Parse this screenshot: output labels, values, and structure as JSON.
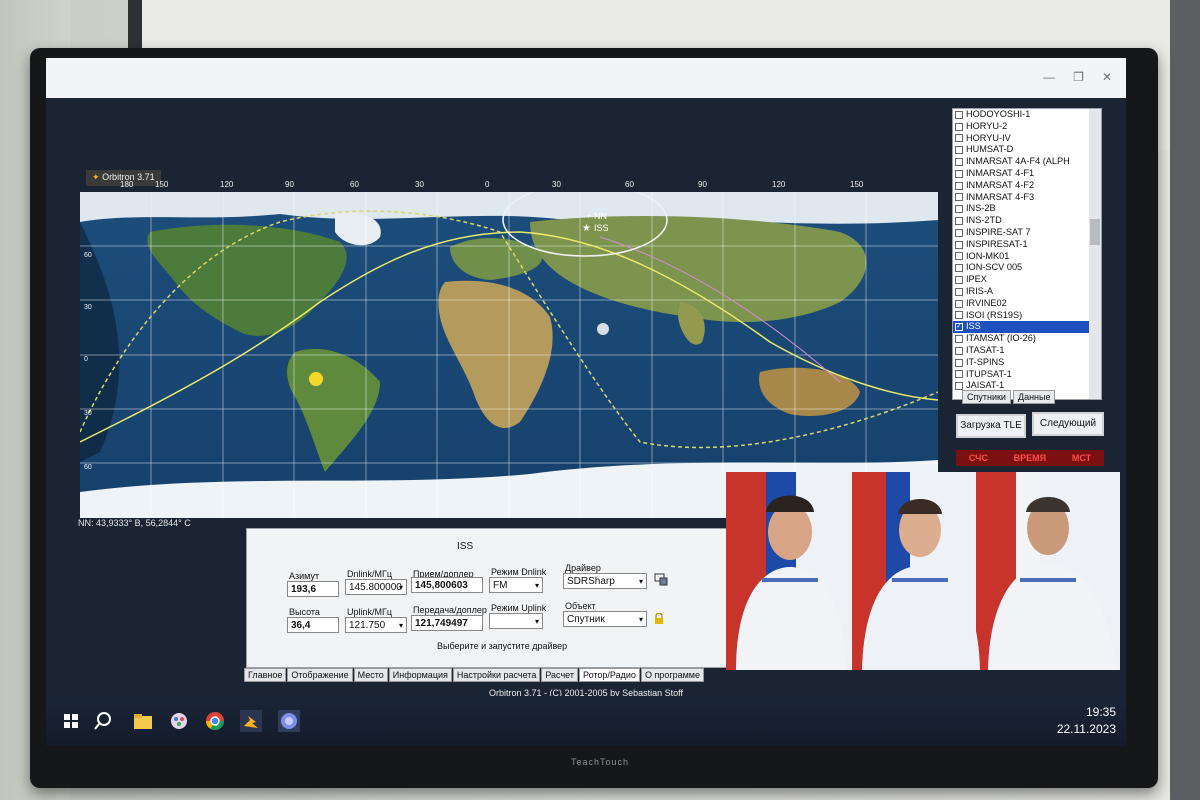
{
  "app": {
    "title": "Orbitron 3.71",
    "footer": "Orbitron 3.71 - (C) 2001-2005 by Sebastian Stoff",
    "device_brand": "TeachTouch"
  },
  "map": {
    "top_coords": [
      "180",
      "150",
      "120",
      "90",
      "60",
      "30",
      "0",
      "30",
      "60",
      "90",
      "120",
      "150"
    ],
    "labels": {
      "observer": "NN",
      "satellite": "ISS"
    },
    "observer_readout": "NN: 43,9333° В, 56,2844° С",
    "left_coords": [
      "60",
      "30",
      "0",
      "30",
      "60"
    ]
  },
  "satellites": {
    "items": [
      "HODOYOSHI-1",
      "HORYU-2",
      "HORYU-IV",
      "HUMSAT-D",
      "INMARSAT 4A-F4 (ALPH",
      "INMARSAT 4-F1",
      "INMARSAT 4-F2",
      "INMARSAT 4-F3",
      "INS-2B",
      "INS-2TD",
      "INSPIRE-SAT 7",
      "INSPIRESAT-1",
      "ION-MK01",
      "ION-SCV 005",
      "IPEX",
      "IRIS-A",
      "IRVINE02",
      "ISOI (RS19S)",
      "ISS",
      "ITAMSAT (IO-26)",
      "ITASAT-1",
      "IT-SPINS",
      "ITUPSAT-1",
      "JAISAT-1"
    ],
    "selected": "ISS",
    "tabs": [
      "Спутники",
      "Данные"
    ]
  },
  "buttons": {
    "load_tle": "Загрузка TLE",
    "next": "Следующий"
  },
  "status": {
    "labels": [
      "СЧС",
      "ВРЕМЯ",
      "МСТ"
    ],
    "color": "#ff4f4f"
  },
  "radio": {
    "title": "ISS",
    "azimuth_label": "Азимут",
    "azimuth": "193,6",
    "height_label": "Высота",
    "height": "36,4",
    "dnlink_label": "Dnlink/МГц",
    "dnlink": "145.800000",
    "uplink_label": "Uplink/МГц",
    "uplink": "121.750",
    "rx_label": "Прием/доплер",
    "rx": "145,800603",
    "tx_label": "Передача/доплер",
    "tx": "121,749497",
    "mode_dn_label": "Режим Dnlink",
    "mode_dn": "FM",
    "mode_up_label": "Режим Uplink",
    "mode_up": "",
    "driver_label": "Драйвер",
    "driver": "SDRSharp",
    "object_label": "Объект",
    "object": "Спутник",
    "hint": "Выберите и запустите драйвер"
  },
  "bottom_tabs": [
    "Главное",
    "Отображение",
    "Место",
    "Информация",
    "Настройки расчета",
    "Расчет",
    "Ротор/Радио",
    "О программе"
  ],
  "taskbar": {
    "time": "19:35",
    "date": "22.11.2023",
    "icons": [
      "windows-icon",
      "search-icon",
      "file-explorer-icon",
      "paint-icon",
      "chrome-icon",
      "orbitron-icon",
      "app-icon"
    ]
  },
  "colors": {
    "selection": "#1d4fbf",
    "taskbar": "#1b2538"
  }
}
